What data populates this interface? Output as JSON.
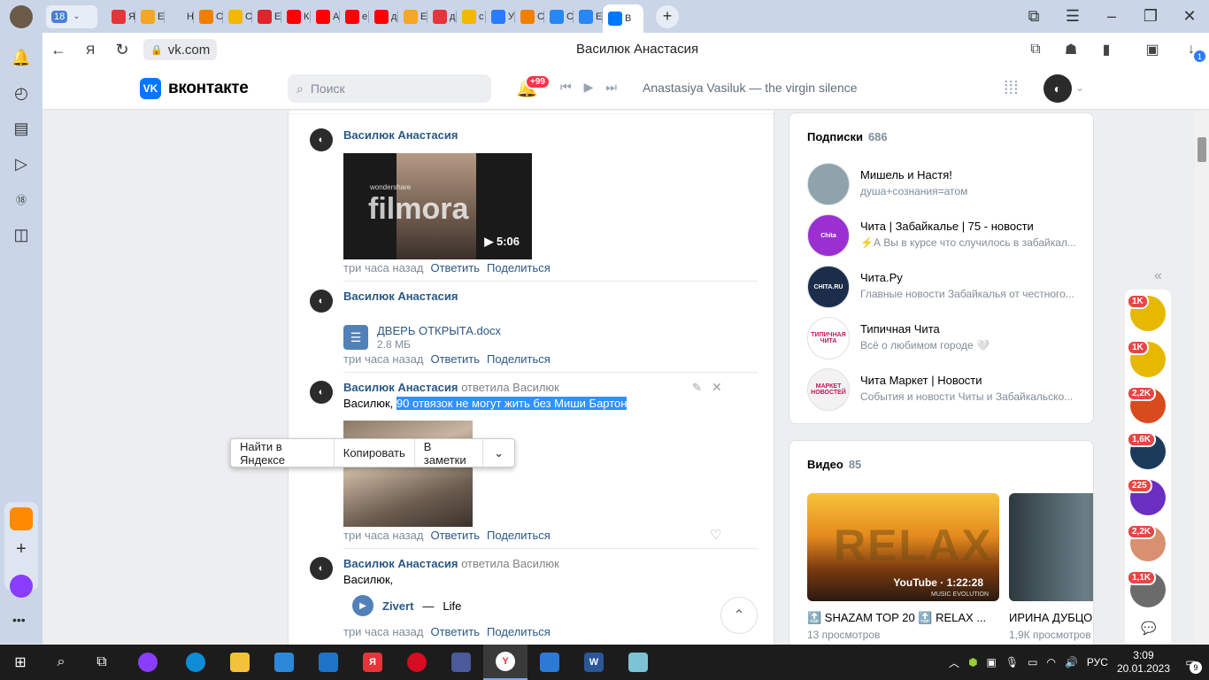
{
  "browser": {
    "tab_count": "18",
    "tabs": [
      {
        "label": "Я",
        "color": "#e6343a"
      },
      {
        "label": "Е",
        "color": "#f5a623"
      },
      {
        "label": "Н",
        "color": "#cad6e8"
      },
      {
        "label": "С",
        "color": "#f07f00"
      },
      {
        "label": "С",
        "color": "#f5b700"
      },
      {
        "label": "Е",
        "color": "#e0242b"
      },
      {
        "label": "К",
        "color": "#ff0000"
      },
      {
        "label": "А",
        "color": "#ff0000"
      },
      {
        "label": "е",
        "color": "#ff0000"
      },
      {
        "label": "д",
        "color": "#ff0000"
      },
      {
        "label": "Е",
        "color": "#f5a623"
      },
      {
        "label": "д",
        "color": "#e6343a"
      },
      {
        "label": "с",
        "color": "#f5b700"
      },
      {
        "label": "У",
        "color": "#2b7bff"
      },
      {
        "label": "С",
        "color": "#f07f00"
      },
      {
        "label": "С",
        "color": "#2787f5"
      },
      {
        "label": "Е",
        "color": "#2787f5"
      },
      {
        "label": "В",
        "color": "#0077ff"
      }
    ],
    "url": "vk.com",
    "page_title": "Василюк Анастасия",
    "download_badge": "1",
    "bookmark_badge": "1"
  },
  "vk_header": {
    "logo_text": "вконтакте",
    "search_placeholder": "Поиск",
    "notif_badge": "+99",
    "now_playing": "Anastasiya Vasiluk — the virgin silence"
  },
  "comments": [
    {
      "author": "Василюк Анастасия",
      "attachment_type": "video",
      "video_duration": "5:06",
      "video_watermark": "filmora",
      "video_watermark_small": "wondershare",
      "time": "три часа назад",
      "reply": "Ответить",
      "share": "Поделиться"
    },
    {
      "author": "Василюк Анастасия",
      "doc_name": "ДВЕРЬ ОТКРЫТА.docx",
      "doc_size": "2.8 МБ",
      "time": "три часа назад",
      "reply": "Ответить",
      "share": "Поделиться"
    },
    {
      "author": "Василюк Анастасия",
      "replied_to": "ответила Василюк",
      "text_prefix": "Василюк, ",
      "text_selected": "90 отвязок не могут жить без Миши Бартон",
      "time": "три часа назад",
      "reply": "Ответить",
      "share": "Поделиться"
    },
    {
      "author": "Василюк Анастасия",
      "replied_to": "ответила Василюк",
      "text_prefix": "Василюк,",
      "audio_artist": "Zivert",
      "audio_sep": "—",
      "audio_title": "Life",
      "time": "три часа назад",
      "reply": "Ответить",
      "share": "Поделиться"
    }
  ],
  "context_menu": {
    "find": "Найти в Яндексе",
    "copy": "Копировать",
    "notes": "В заметки"
  },
  "subscriptions": {
    "title": "Подписки",
    "count": "686",
    "items": [
      {
        "name": "Мишель и Настя!",
        "desc": "душа+сознания=атом",
        "color": "#8fa3ad"
      },
      {
        "name": "Чита | Забайкалье | 75 - новости",
        "desc": "⚡А Вы в курсе что случилось в забайкал...",
        "color": "#9b2fd1",
        "ava_text": "Chita"
      },
      {
        "name": "Чита.Ру",
        "desc": "Главные новости Забайкалья от честного...",
        "color": "#1b2d4a",
        "ava_text": "CHITA.RU"
      },
      {
        "name": "Типичная Чита",
        "desc": "Всё о любимом городе 🤍",
        "color": "#ffffff",
        "ava_text": "ТИПИЧНАЯ ЧИТА"
      },
      {
        "name": "Чита Маркет | Новости",
        "desc": "События и новости Читы и Забайкальско...",
        "color": "#f2f2f2",
        "ava_text": "МАРКЕТ НОВОСТЕЙ"
      }
    ]
  },
  "videos": {
    "title": "Видео",
    "count": "85",
    "items": [
      {
        "title": "🔝 SHAZAM TOP 20 🔝 RELAX ...",
        "views": "13 просмотров",
        "badge": "YouTube · 1:22:28",
        "overlay": "RELAX",
        "overlay_small": "MUSIC EVOLUTION"
      },
      {
        "title": "ИРИНА ДУБЦОВА",
        "views": "1,9К просмотров"
      }
    ]
  },
  "rail": [
    {
      "badge": "1K",
      "color": "#e6b800"
    },
    {
      "badge": "1K",
      "color": "#e6b800"
    },
    {
      "badge": "2,2K",
      "color": "#d84b1e"
    },
    {
      "badge": "1,6K",
      "color": "#1c3a5a"
    },
    {
      "badge": "225",
      "color": "#6a2fc1"
    },
    {
      "badge": "2,2K",
      "color": "#d89070"
    },
    {
      "badge": "1,1K",
      "color": "#6b6b6b"
    }
  ],
  "taskbar": {
    "lang": "РУС",
    "time": "3:09",
    "date": "20.01.2023",
    "notif_count": "9"
  }
}
